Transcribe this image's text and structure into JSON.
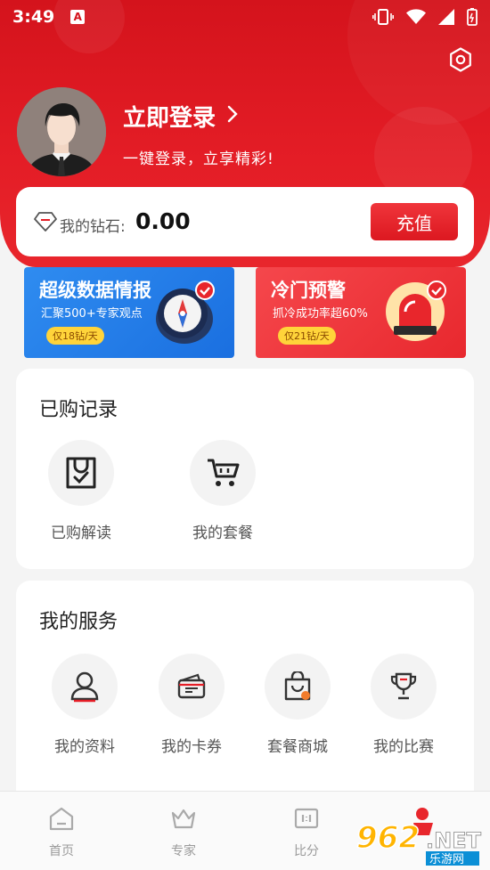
{
  "status_bar": {
    "time": "3:49",
    "notification_letter": "A"
  },
  "profile": {
    "login_title": "立即登录",
    "login_subtitle": "一键登录，立享精彩!"
  },
  "wallet": {
    "label": "我的钻石:",
    "value": "0.00",
    "recharge_label": "充值"
  },
  "banners": [
    {
      "title": "超级数据情报",
      "subtitle": "汇聚500+专家观点",
      "tag": "仅18钻/天",
      "icon": "compass-icon"
    },
    {
      "title": "冷门预警",
      "subtitle": "抓冷成功率超60%",
      "tag": "仅21钻/天",
      "icon": "alarm-siren-icon"
    }
  ],
  "purchased": {
    "title": "已购记录",
    "items": [
      {
        "label": "已购解读",
        "icon": "purchased-check-icon"
      },
      {
        "label": "我的套餐",
        "icon": "cart-icon"
      }
    ]
  },
  "services": {
    "title": "我的服务",
    "items": [
      {
        "label": "我的资料",
        "icon": "user-icon"
      },
      {
        "label": "我的卡券",
        "icon": "wallet-icon"
      },
      {
        "label": "套餐商城",
        "icon": "shopping-bag-icon"
      },
      {
        "label": "我的比赛",
        "icon": "trophy-icon"
      }
    ]
  },
  "bottom_nav": [
    {
      "label": "首页",
      "icon": "home-icon"
    },
    {
      "label": "专家",
      "icon": "crown-icon"
    },
    {
      "label": "比分",
      "icon": "scoreboard-icon"
    }
  ],
  "colors": {
    "brand_red": "#e41d26",
    "banner_blue": "#2f8cf0",
    "tag_yellow": "#ffd43a"
  }
}
